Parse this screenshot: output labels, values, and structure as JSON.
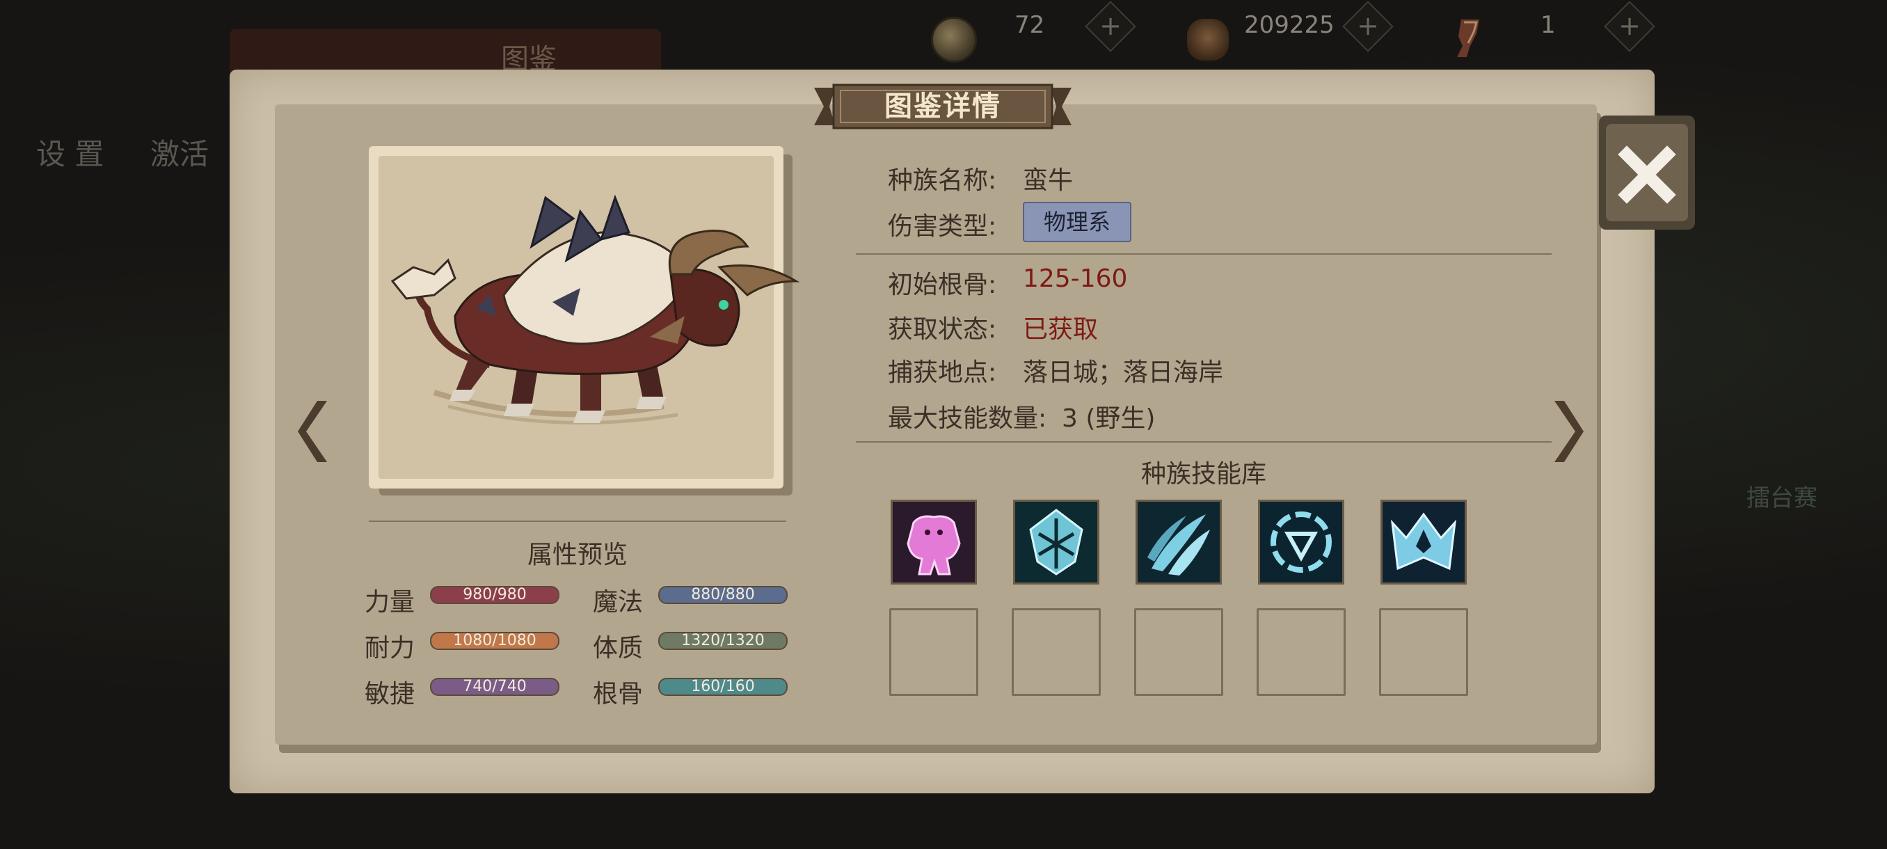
{
  "background": {
    "title": "图鉴",
    "nav": [
      "设 置",
      "激活"
    ],
    "arena_label": "擂台赛"
  },
  "resources": [
    {
      "icon": "coin-icon",
      "value": "72"
    },
    {
      "icon": "gold-stack-icon",
      "value": "209225"
    },
    {
      "icon": "scroll-icon",
      "value": "1"
    }
  ],
  "header": {
    "title": "图鉴详情"
  },
  "creature": {
    "image": "bull-creature-image"
  },
  "info": {
    "species_label": "种族名称:",
    "species_value": "蛮牛",
    "damage_label": "伤害类型:",
    "damage_value": "物理系",
    "bone_label": "初始根骨:",
    "bone_value": "125-160",
    "status_label": "获取状态:",
    "status_value": "已获取",
    "location_label": "捕获地点:",
    "location_value": "落日城；落日海岸",
    "maxskill_label": "最大技能数量:",
    "maxskill_value": "3 (野生)"
  },
  "attributes": {
    "title": "属性预览",
    "items": [
      {
        "label": "力量",
        "value": "980/980",
        "color": "#8c3f4a"
      },
      {
        "label": "魔法",
        "value": "880/880",
        "color": "#5b6c8e"
      },
      {
        "label": "耐力",
        "value": "1080/1080",
        "color": "#c0784a"
      },
      {
        "label": "体质",
        "value": "1320/1320",
        "color": "#6f7a64"
      },
      {
        "label": "敏捷",
        "value": "740/740",
        "color": "#7a5c86"
      },
      {
        "label": "根骨",
        "value": "160/160",
        "color": "#4f8a8a"
      }
    ]
  },
  "skills": {
    "title": "种族技能库",
    "icons": [
      "pink-golem-skill-icon",
      "ice-shield-skill-icon",
      "claw-slash-skill-icon",
      "rune-circle-skill-icon",
      "crown-wing-skill-icon"
    ],
    "empty_slots": 5
  },
  "colors": {
    "panel": "#cbbfa9",
    "accent_red": "#7e1a14",
    "ribbon": "#6a5640"
  }
}
